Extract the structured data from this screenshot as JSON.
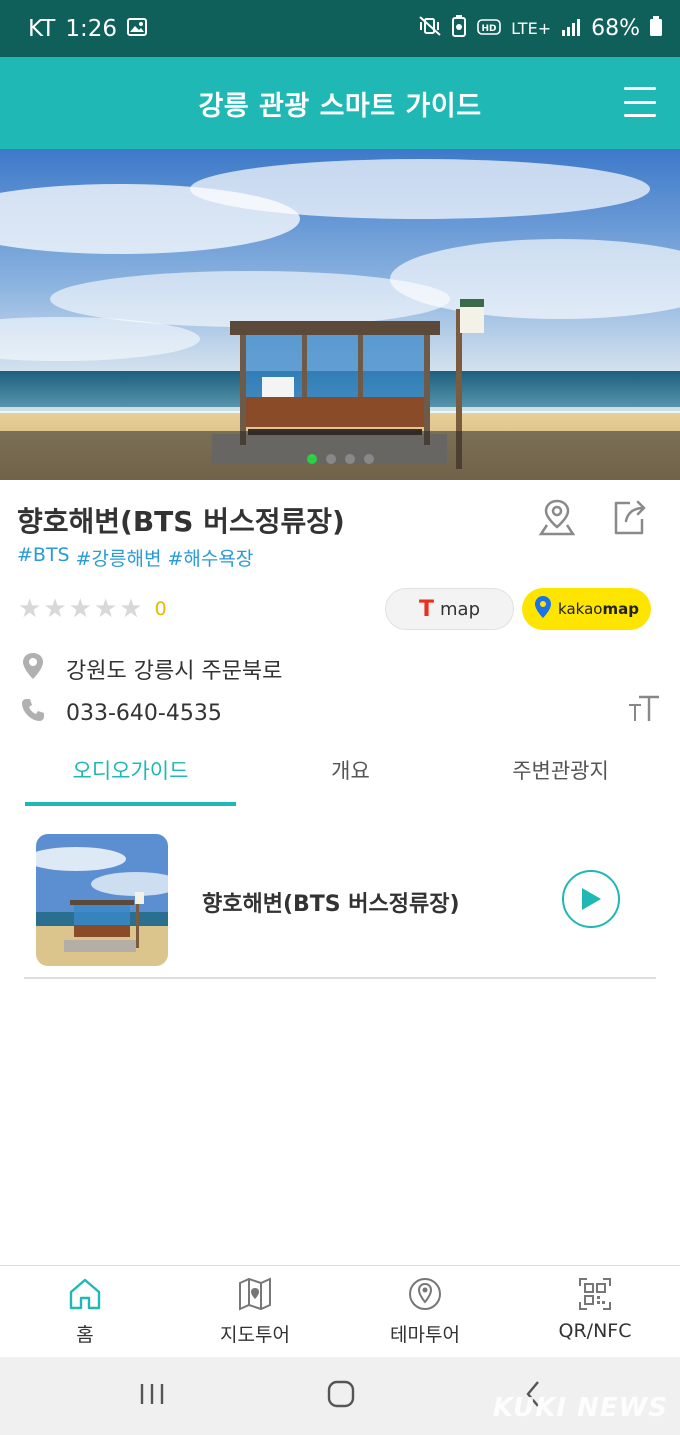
{
  "status_bar": {
    "carrier": "KT",
    "time": "1:26",
    "network": "LTE+",
    "battery": "68%"
  },
  "header": {
    "title": "강릉 관광 스마트 가이드"
  },
  "hero": {
    "image": "bus-stop-beach-photo",
    "slide_count": 4,
    "active_slide": 1
  },
  "place": {
    "title": "향호해변(BTS 버스정류장)",
    "tags": [
      "#BTS",
      "#강릉해변",
      "#해수욕장"
    ],
    "rating_stars": 0,
    "rating_count": "0",
    "address": "강원도 강릉시 주문북로",
    "phone": "033-640-4535"
  },
  "map_buttons": {
    "tmap_label": "map",
    "kakao_label_left": "kakao",
    "kakao_label_right": "map"
  },
  "tabs": [
    {
      "label": "오디오가이드",
      "active": true
    },
    {
      "label": "개요",
      "active": false
    },
    {
      "label": "주변관광지",
      "active": false
    }
  ],
  "audio_list": [
    {
      "title": "향호해변(BTS 버스정류장)"
    }
  ],
  "bottom_nav": [
    {
      "label": "홈",
      "icon": "home-icon",
      "active": true
    },
    {
      "label": "지도투어",
      "icon": "map-icon",
      "active": false
    },
    {
      "label": "테마투어",
      "icon": "theme-pin-icon",
      "active": false
    },
    {
      "label": "QR/NFC",
      "icon": "qr-icon",
      "active": false
    }
  ],
  "watermark": "KUKI NEWS",
  "colors": {
    "accent": "#1fb8b4",
    "status_bar": "#0f5f5a",
    "tag": "#2a9ad8",
    "rating": "#e6b800",
    "kakao": "#fee500"
  }
}
